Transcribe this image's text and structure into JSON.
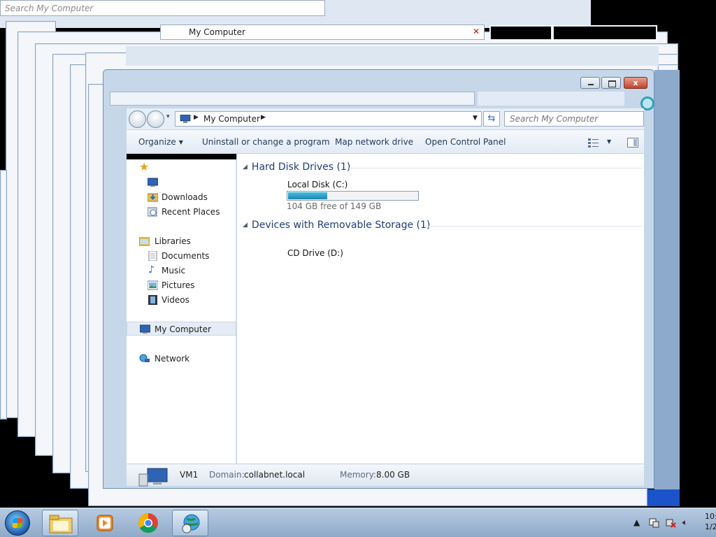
{
  "ghost": {
    "search_placeholder": "Search My Computer",
    "address": "My Computer"
  },
  "window": {
    "close_glyph": "x"
  },
  "nav": {
    "address": "My Computer",
    "search_placeholder": "Search My Computer",
    "refresh_icon": "refresh-icon"
  },
  "toolbar": {
    "organize": "Organize",
    "uninstall": "Uninstall or change a program",
    "map_drive": "Map network drive",
    "control_panel": "Open Control Panel"
  },
  "sidebar": {
    "favorites_icon": "star-icon",
    "items": [
      {
        "label": "Downloads",
        "icon": "downloads-icon"
      },
      {
        "label": "Recent Places",
        "icon": "recent-places-icon"
      },
      {
        "label": "Libraries",
        "icon": "libraries-icon"
      },
      {
        "label": "Documents",
        "icon": "documents-icon"
      },
      {
        "label": "Music",
        "icon": "music-icon"
      },
      {
        "label": "Pictures",
        "icon": "pictures-icon"
      },
      {
        "label": "Videos",
        "icon": "videos-icon"
      },
      {
        "label": "My Computer",
        "icon": "computer-icon"
      },
      {
        "label": "Network",
        "icon": "network-icon"
      }
    ]
  },
  "content": {
    "hdd_group": "Hard Disk Drives (1)",
    "local_disk": {
      "name": "Local Disk (C:)",
      "free_text": "104 GB free of 149 GB",
      "used_fraction": 0.3
    },
    "removable_group": "Devices with Removable Storage (1)",
    "cd_drive": "CD Drive (D:)"
  },
  "details": {
    "computer_name": "VM1",
    "domain_label": "Domain:",
    "domain_value": "collabnet.local",
    "memory_label": "Memory:",
    "memory_value": "8.00 GB"
  },
  "taskbar": {
    "clock_time": "10:",
    "clock_date": "1/2"
  },
  "colors": {
    "progress_fill": "#1a86b4",
    "accent_text": "#1e3d73"
  }
}
